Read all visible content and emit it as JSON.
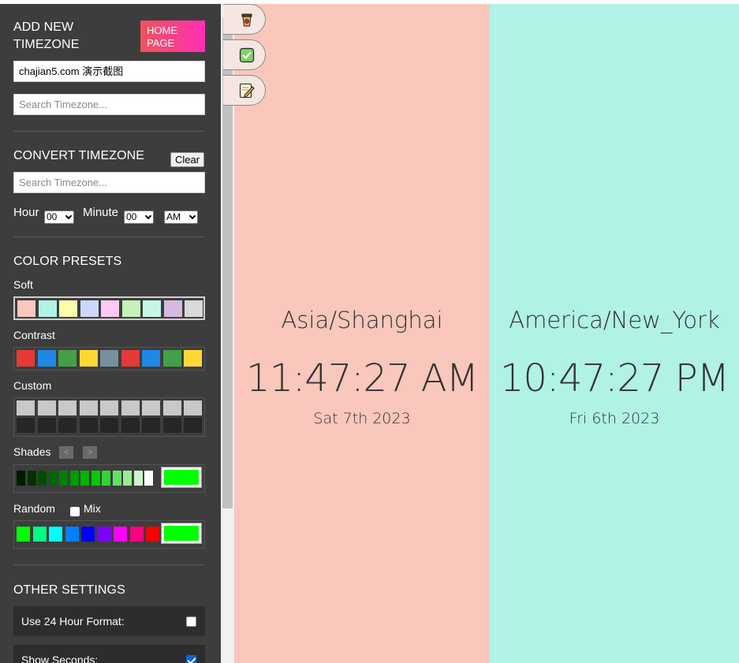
{
  "add_timezone": {
    "title_line1": "ADD NEW",
    "title_line2": "TIMEZONE",
    "home_line1": "HOME",
    "home_line2": "PAGE",
    "name_value": "chajian5.com 演示截图",
    "search_placeholder": "Search Timezone..."
  },
  "convert": {
    "title": "CONVERT TIMEZONE",
    "clear_label": "Clear",
    "search_placeholder": "Search Timezone...",
    "hour_label": "Hour",
    "hour_value": "00",
    "minute_label": "Minute",
    "minute_value": "00",
    "ampm_value": "AM"
  },
  "presets": {
    "title": "COLOR PRESETS",
    "soft_label": "Soft",
    "soft_colors": [
      "#f9c7bc",
      "#b0f2e5",
      "#fdfbad",
      "#ccd8fb",
      "#fbc9f4",
      "#c5f2b6",
      "#c6f6e6",
      "#d5b9e0",
      "#d9d9d9"
    ],
    "contrast_label": "Contrast",
    "contrast_colors": [
      "#e53935",
      "#1e88e5",
      "#43a047",
      "#fdd835",
      "#78909c",
      "#e53935",
      "#1e88e5",
      "#43a047",
      "#fdd835"
    ],
    "custom_label": "Custom",
    "custom_top": "#c8c8c8",
    "custom_bottom": "#262626",
    "shades_label": "Shades",
    "shades_prev": "<",
    "shades_next": ">",
    "shades_colors": [
      "#001a00",
      "#003300",
      "#004d00",
      "#006600",
      "#008000",
      "#009900",
      "#00b300",
      "#00cc00",
      "#33d633",
      "#66e066",
      "#99eb99",
      "#ccf5cc",
      "#ffffff"
    ],
    "shades_selected": "#00ff00",
    "random_label": "Random",
    "mix_label": "Mix",
    "random_colors": [
      "#00ff00",
      "#00ff80",
      "#00ffff",
      "#0080ff",
      "#0000ff",
      "#8000ff",
      "#ff00ff",
      "#ff0080",
      "#ff0000"
    ],
    "random_selected": "#00ff00"
  },
  "other": {
    "title": "OTHER SETTINGS",
    "use24_label": "Use 24 Hour Format:",
    "show_seconds_label": "Show Seconds:"
  },
  "clocks": [
    {
      "zone": "Asia/Shanghai",
      "time": "11:47:27 AM",
      "date": "Sat 7th 2023",
      "bg": "#f9c7bc"
    },
    {
      "zone": "America/New_York",
      "time": "10:47:27 PM",
      "date": "Fri 6th 2023",
      "bg": "#b0f2e5"
    }
  ],
  "tools": [
    "coffee-icon",
    "check-icon",
    "edit-icon"
  ]
}
